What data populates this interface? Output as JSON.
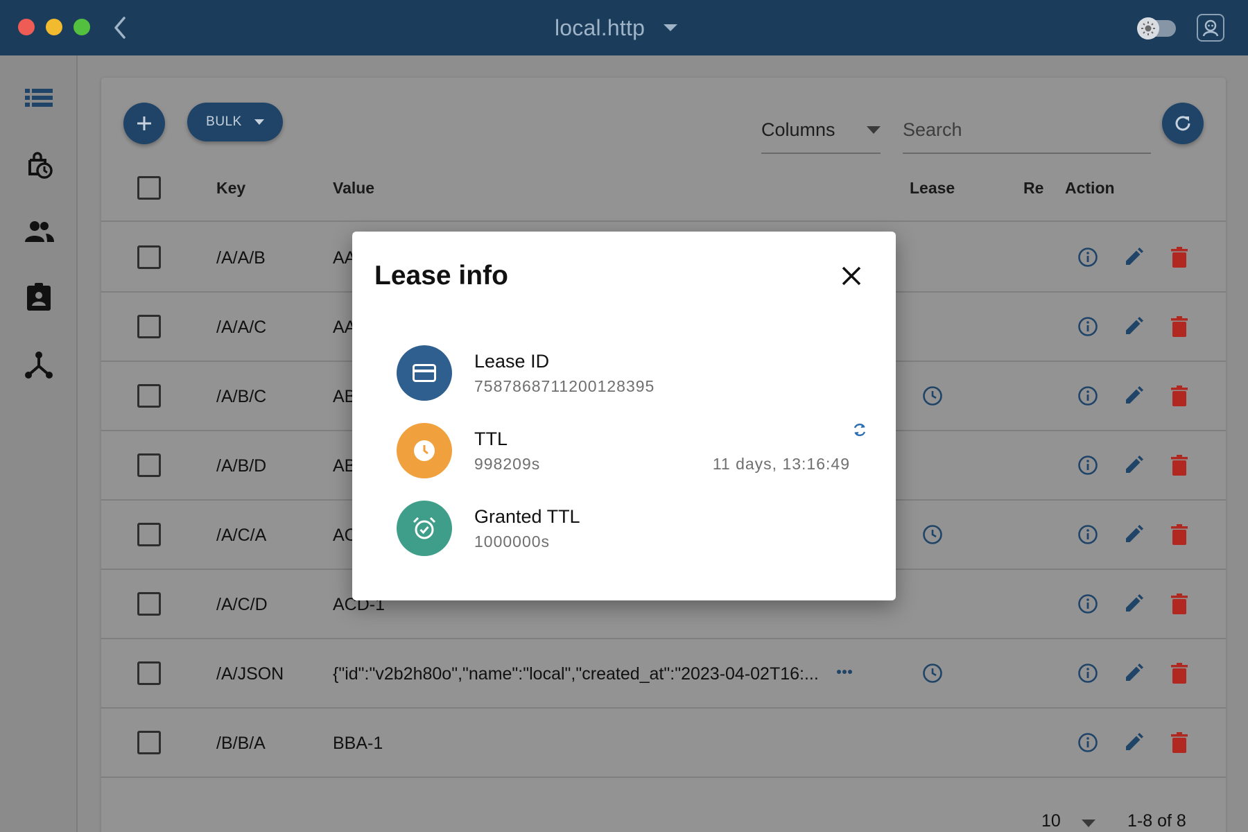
{
  "window": {
    "title": "local.http",
    "icons": [
      "back-icon",
      "dropdown-icon",
      "theme-toggle",
      "avatar-icon"
    ]
  },
  "sidebar": {
    "items": [
      {
        "icon": "list-icon"
      },
      {
        "icon": "lease-icon"
      },
      {
        "icon": "users-icon"
      },
      {
        "icon": "roles-icon"
      },
      {
        "icon": "cluster-icon"
      }
    ]
  },
  "toolbar": {
    "bulk_label": "BULK",
    "columns_label": "Columns",
    "search_placeholder": "Search"
  },
  "table": {
    "headers": {
      "key": "Key",
      "value": "Value",
      "lease": "Lease",
      "revision": "Re",
      "action": "Action"
    },
    "rows": [
      {
        "key": "/A/A/B",
        "value": "AA",
        "lease": false
      },
      {
        "key": "/A/A/C",
        "value": "AA",
        "lease": false
      },
      {
        "key": "/A/B/C",
        "value": "AB",
        "lease": true
      },
      {
        "key": "/A/B/D",
        "value": "AB",
        "lease": false
      },
      {
        "key": "/A/C/A",
        "value": "AC",
        "lease": true
      },
      {
        "key": "/A/C/D",
        "value": "ACD-1",
        "lease": false
      },
      {
        "key": "/A/JSON",
        "value": "{\"id\":\"v2b2h80o\",\"name\":\"local\",\"created_at\":\"2023-04-02T16:...",
        "lease": true,
        "truncated": true
      },
      {
        "key": "/B/B/A",
        "value": "BBA-1",
        "lease": false
      }
    ]
  },
  "pagination": {
    "rows_per_page": "10",
    "range": "1-8 of 8"
  },
  "modal": {
    "title": "Lease info",
    "lease_id_label": "Lease ID",
    "lease_id_value": "7587868711200128395",
    "ttl_label": "TTL",
    "ttl_value": "998209s",
    "ttl_readable": "11 days, 13:16:49",
    "granted_label": "Granted TTL",
    "granted_value": "1000000s"
  },
  "colors": {
    "titlebar": "#1b3c5b",
    "primary": "#1f4468",
    "delete": "#b0281f",
    "lease_avatar": "#2e5f8f",
    "ttl_avatar": "#f0a03c",
    "granted_avatar": "#3f9e8a"
  }
}
